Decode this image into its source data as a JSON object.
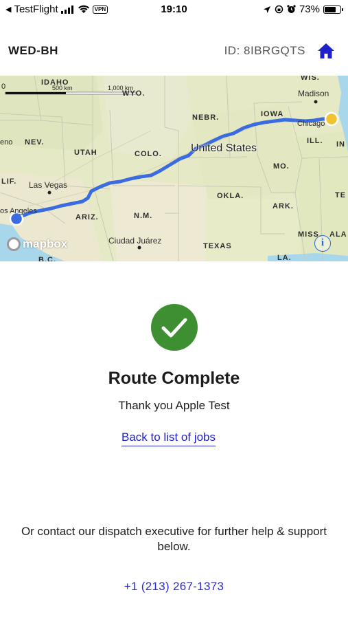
{
  "status_bar": {
    "back_app": "TestFlight",
    "vpn": "VPN",
    "time": "19:10",
    "battery": "73%",
    "battery_level": 0.73
  },
  "header": {
    "job_code": "WED-BH",
    "job_id": "ID: 8IBRGQTS",
    "home_icon": "home-icon"
  },
  "map": {
    "scale_start": "0",
    "scale_500": "500 km",
    "scale_1000": "1,000 km",
    "country": "United States",
    "states": {
      "idaho": "IDAHO",
      "wyo": "WYO.",
      "wis": "WIS.",
      "nebr": "NEBR.",
      "iowa": "IOWA",
      "nev": "NEV.",
      "utah": "UTAH",
      "colo": "COLO.",
      "ill": "ILL.",
      "ind": "IN",
      "mo": "MO.",
      "calif": "LIF.",
      "okla": "OKLA.",
      "ark": "ARK.",
      "tenn": "TE",
      "ariz": "ARIZ.",
      "nm": "N.M.",
      "texas": "TEXAS",
      "miss": "MISS.",
      "ala": "ALA",
      "la": "LA.",
      "bc": "B.C.",
      "eno": "eno"
    },
    "cities": {
      "madison": "Madison",
      "chicago": "Chicago",
      "las_vegas": "Las Vegas",
      "los_angeles": "os Angeles",
      "ciudad_juarez": "Ciudad Juárez"
    },
    "attribution": "mapbox",
    "info": "i",
    "route_color": "#3a6be0",
    "start_color": "#3a6be0",
    "end_color": "#f2c230"
  },
  "completion": {
    "check_color": "#3e8f32",
    "title": "Route Complete",
    "thanks": "Thank you Apple Test",
    "back_link": "Back to list of jobs",
    "contact_text": "Or contact our dispatch executive for further help & support below.",
    "phone": "+1 (213) 267-1373"
  }
}
